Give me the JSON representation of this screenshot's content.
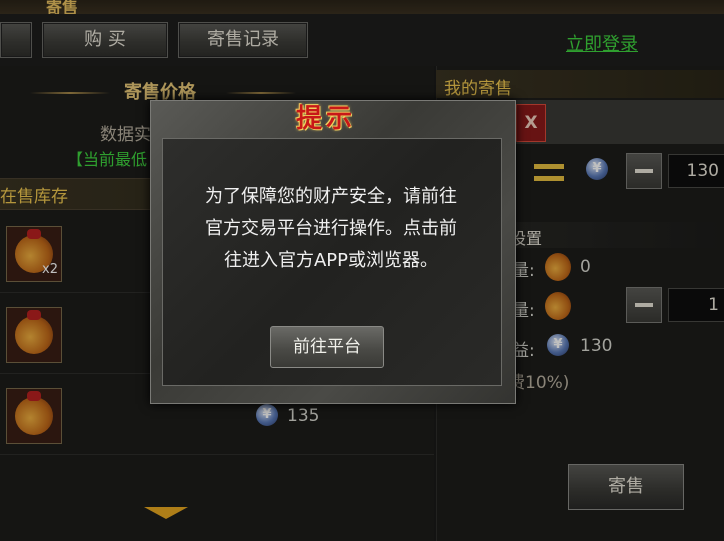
{
  "header": {
    "title": "寄售"
  },
  "tabs": [
    {
      "label": "购 买"
    },
    {
      "label": "寄售记录"
    }
  ],
  "login_link": "立即登录",
  "left": {
    "price_title": "寄售价格",
    "data_label": "数据实",
    "lowest_label": "【当前最低",
    "stock_title": "在售库存",
    "items": [
      {
        "qty": "x2",
        "price": ""
      },
      {
        "qty": "",
        "price": ""
      },
      {
        "qty": "",
        "price": "135"
      }
    ]
  },
  "right": {
    "my_sale_title": "我的寄售",
    "close_label": "X",
    "price_value": "130",
    "settings_title": "设置",
    "row1_suffix": "量:",
    "row1_value": "0",
    "row2_suffix": "量:",
    "row2_value": "1",
    "row3_suffix": "益:",
    "row3_value": "130",
    "fee_text": "费10%)",
    "sell_label": "寄售"
  },
  "dialog": {
    "title": "提示",
    "lines": [
      "为了保障您的财产安全，请前往",
      "官方交易平台进行操作。点击前",
      "往进入官方APP或浏览器。"
    ],
    "button_label": "前往平台"
  },
  "colors": {
    "accent_green": "#3fd43f",
    "gold": "#f0c850",
    "dialog_title": "#c81818"
  }
}
